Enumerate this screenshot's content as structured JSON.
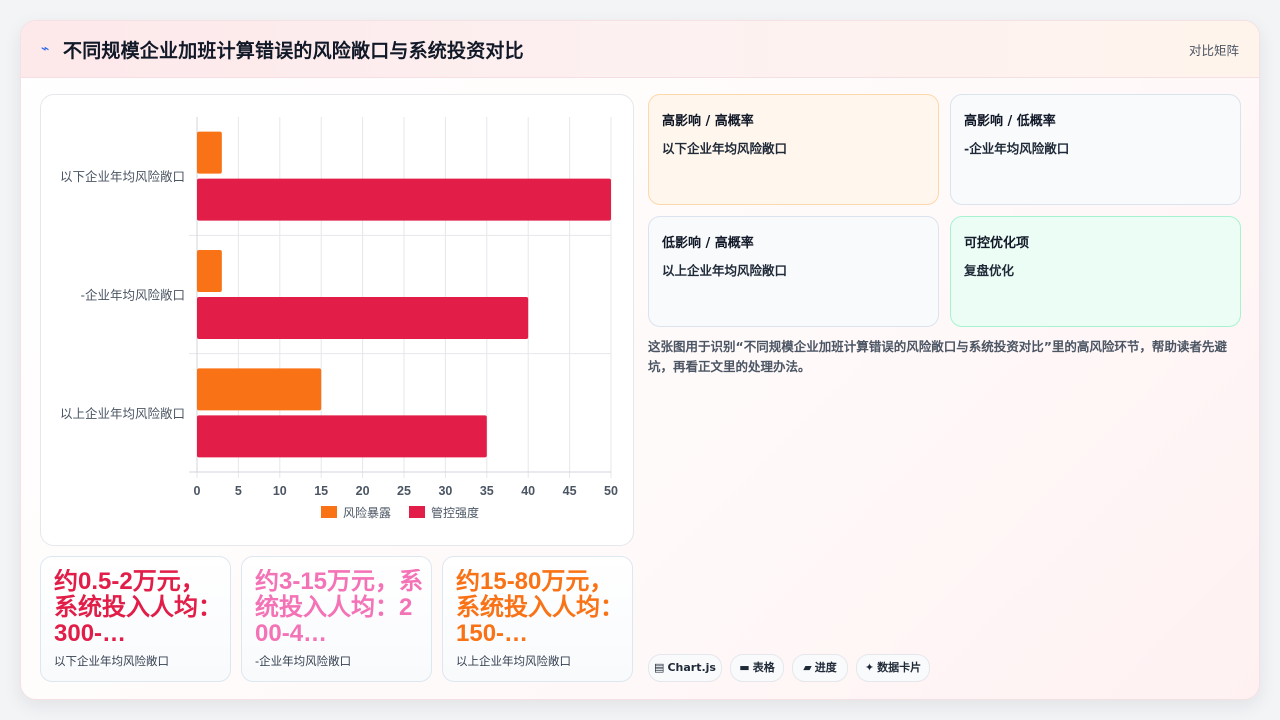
{
  "header": {
    "icon": "zap-icon",
    "title": "不同规模企业加班计算错误的风险敞口与系统投资对比",
    "tag": "对比矩阵"
  },
  "chart_data": {
    "type": "bar",
    "orientation": "horizontal",
    "categories": [
      "以下企业年均风险敞口",
      "-企业年均风险敞口",
      "以上企业年均风险敞口"
    ],
    "series": [
      {
        "name": "风险暴露",
        "values": [
          3,
          3,
          15
        ],
        "color": "#f97316"
      },
      {
        "name": "管控强度",
        "values": [
          50,
          40,
          35
        ],
        "color": "#e11d48"
      }
    ],
    "x_ticks": [
      "0",
      "5",
      "10",
      "15",
      "20",
      "25",
      "30",
      "35",
      "40",
      "45",
      "50"
    ],
    "xlim": [
      0,
      50
    ],
    "grid": true,
    "legend": "bottom"
  },
  "stats": [
    {
      "value": "约0.5-2万元，系统投入人均：300-…",
      "label": "以下企业年均风险敞口",
      "color": "#e11d48"
    },
    {
      "value": "约3-15万元，系统投入人均：200-4…",
      "label": "-企业年均风险敞口",
      "color": "#f472b6"
    },
    {
      "value": "约15-80万元，系统投入人均：150-…",
      "label": "以上企业年均风险敞口",
      "color": "#f97316"
    }
  ],
  "matrix": [
    {
      "title": "高影响 / 高概率",
      "item": "以下企业年均风险敞口",
      "bg": "#fff7ed",
      "border": "#fed7aa"
    },
    {
      "title": "高影响 / 低概率",
      "item": "-企业年均风险敞口",
      "bg": "#f8fafc",
      "border": "#dbe3ee"
    },
    {
      "title": "低影响 / 高概率",
      "item": "以上企业年均风险敞口",
      "bg": "#f8fafc",
      "border": "#dbe3ee"
    },
    {
      "title": "可控优化项",
      "item": "复盘优化",
      "bg": "#ecfdf5",
      "border": "#a7f3d0"
    }
  ],
  "description": "这张图用于识别“不同规模企业加班计算错误的风险敞口与系统投资对比”里的高风险环节，帮助读者先避坑，再看正文里的处理办法。",
  "chips": [
    {
      "icon": "▤",
      "label": "Chart.js"
    },
    {
      "icon": "▬",
      "label": "表格"
    },
    {
      "icon": "▰",
      "label": "进度"
    },
    {
      "icon": "✦",
      "label": "数据卡片"
    }
  ]
}
